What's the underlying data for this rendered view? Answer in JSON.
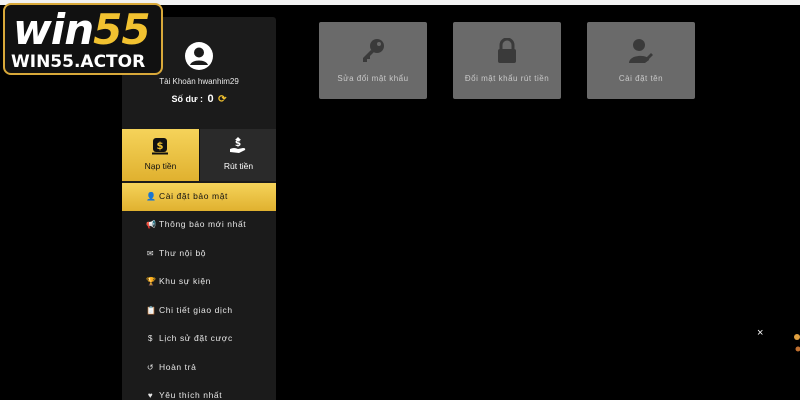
{
  "logo": {
    "brand_a": "win",
    "brand_b": "55",
    "domain": "WIN55.ACTOR"
  },
  "profile": {
    "account": "Tài Khoản hwanhim29",
    "balance_label": "Số dư :",
    "balance_value": "0"
  },
  "actions": {
    "deposit": "Nạp tiền",
    "withdraw": "Rút tiền"
  },
  "menu": [
    {
      "label": "Cài đặt bảo mật",
      "icon": "user-gear-icon",
      "active": true
    },
    {
      "label": "Thông báo mới nhất",
      "icon": "megaphone-icon"
    },
    {
      "label": "Thư nội bộ",
      "icon": "envelope-icon"
    },
    {
      "label": "Khu sự kiện",
      "icon": "trophy-icon"
    },
    {
      "label": "Chi tiết giao dịch",
      "icon": "clipboard-icon"
    },
    {
      "label": "Lịch sử đặt cược",
      "icon": "dollar-icon"
    },
    {
      "label": "Hoàn trả",
      "icon": "history-icon"
    },
    {
      "label": "Yêu thích nhất",
      "icon": "heart-icon"
    }
  ],
  "cards": [
    {
      "label": "Sửa đổi mật khẩu",
      "icon": "key-icon"
    },
    {
      "label": "Đổi mật khẩu rút tiền",
      "icon": "lock-icon"
    },
    {
      "label": "Cài đặt tên",
      "icon": "user-edit-icon"
    }
  ],
  "colors": {
    "accent": "#f2c230",
    "sidebar": "#1b1b1b",
    "card": "#6a6a6a",
    "background": "#000000"
  },
  "close_symbol": "×"
}
